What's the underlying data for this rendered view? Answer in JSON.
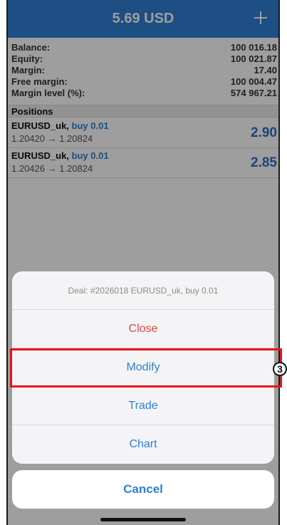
{
  "header": {
    "title": "5.69 USD",
    "add_icon": "plus-icon"
  },
  "account": {
    "rows": [
      {
        "label": "Balance:",
        "value": "100 016.18"
      },
      {
        "label": "Equity:",
        "value": "100 021.87"
      },
      {
        "label": "Margin:",
        "value": "17.40"
      },
      {
        "label": "Free margin:",
        "value": "100 004.47"
      },
      {
        "label": "Margin level (%):",
        "value": "574 967.21"
      }
    ]
  },
  "positions": {
    "title": "Positions",
    "items": [
      {
        "symbol": "EURUSD_uk,",
        "side": "buy 0.01",
        "prices": "1.20420 → 1.20824",
        "profit": "2.90"
      },
      {
        "symbol": "EURUSD_uk,",
        "side": "buy 0.01",
        "prices": "1.20426 → 1.20824",
        "profit": "2.85"
      }
    ]
  },
  "action_sheet": {
    "title": "Deal: #2026018 EURUSD_uk, buy 0.01",
    "items": [
      "Close",
      "Modify",
      "Trade",
      "Chart"
    ],
    "cancel_label": "Cancel"
  },
  "annotation": {
    "step_number": "3",
    "color": "#e8121c"
  },
  "colors": {
    "accent": "#2f7fd6",
    "destructive": "#e0473f"
  }
}
